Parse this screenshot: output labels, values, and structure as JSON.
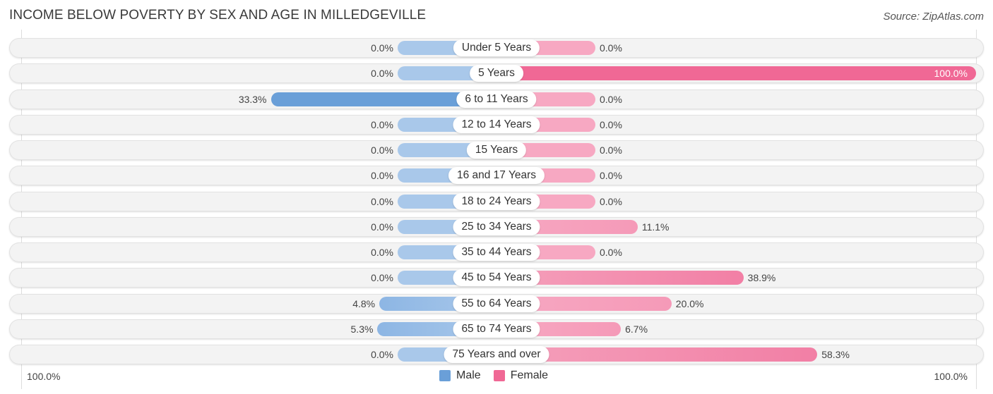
{
  "chart_data": {
    "type": "bar",
    "orientation": "horizontal-diverging",
    "title": "INCOME BELOW POVERTY BY SEX AND AGE IN MILLEDGEVILLE",
    "source": "Source: ZipAtlas.com",
    "categories": [
      "Under 5 Years",
      "5 Years",
      "6 to 11 Years",
      "12 to 14 Years",
      "15 Years",
      "16 and 17 Years",
      "18 to 24 Years",
      "25 to 34 Years",
      "35 to 44 Years",
      "45 to 54 Years",
      "55 to 64 Years",
      "65 to 74 Years",
      "75 Years and over"
    ],
    "series": [
      {
        "name": "Male",
        "color": "#6a9fd8",
        "light_color": "#a9c8ea",
        "values": [
          0.0,
          0.0,
          33.3,
          0.0,
          0.0,
          0.0,
          0.0,
          0.0,
          0.0,
          0.0,
          4.8,
          5.3,
          0.0
        ],
        "labels": [
          "0.0%",
          "0.0%",
          "33.3%",
          "0.0%",
          "0.0%",
          "0.0%",
          "0.0%",
          "0.0%",
          "0.0%",
          "0.0%",
          "4.8%",
          "5.3%",
          "0.0%"
        ]
      },
      {
        "name": "Female",
        "color": "#f06895",
        "light_color": "#f7a8c2",
        "values": [
          0.0,
          100.0,
          0.0,
          0.0,
          0.0,
          0.0,
          0.0,
          11.1,
          0.0,
          38.9,
          20.0,
          6.7,
          58.3
        ],
        "labels": [
          "0.0%",
          "100.0%",
          "0.0%",
          "0.0%",
          "0.0%",
          "0.0%",
          "0.0%",
          "11.1%",
          "0.0%",
          "38.9%",
          "20.0%",
          "6.7%",
          "58.3%"
        ]
      }
    ],
    "xlim": [
      0,
      100
    ],
    "axis_left_label": "100.0%",
    "axis_right_label": "100.0%",
    "legend": [
      "Male",
      "Female"
    ],
    "legend_position": "bottom-center",
    "grid": false
  }
}
